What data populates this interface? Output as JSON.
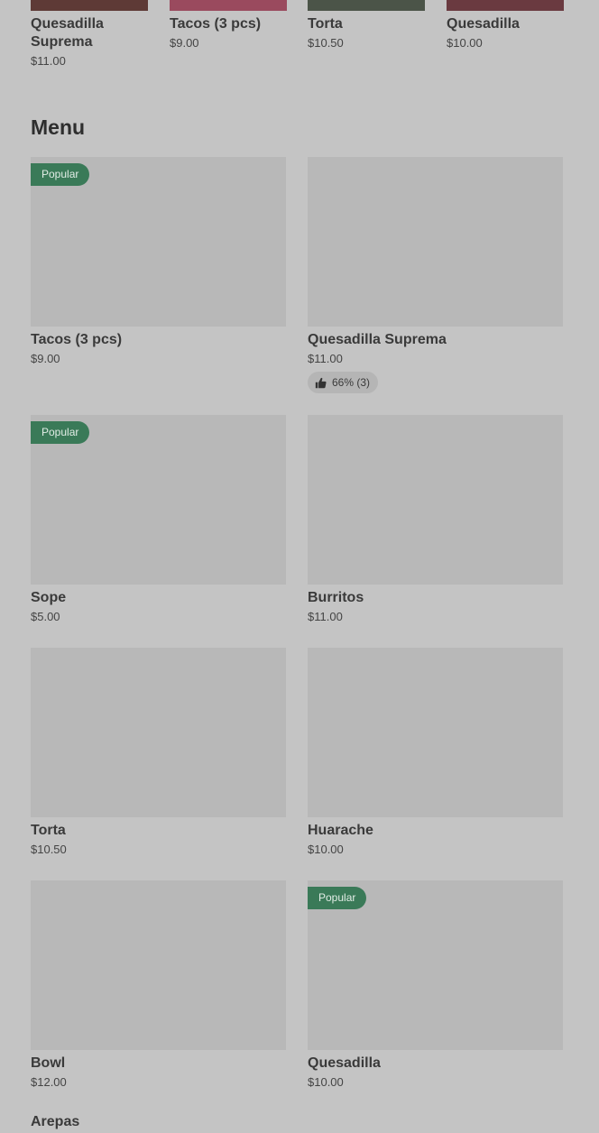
{
  "colors": {
    "background": "#c4c4c4",
    "popular_badge": "#3a7a58",
    "placeholder_image": "#b8b8b8"
  },
  "carousel": {
    "items": [
      {
        "title": "Quesadilla Suprema",
        "price": "$11.00",
        "image_color": "#5e3a36"
      },
      {
        "title": "Tacos (3 pcs)",
        "price": "$9.00",
        "image_color": "#9a4a5e"
      },
      {
        "title": "Torta",
        "price": "$10.50",
        "image_color": "#4b5448"
      },
      {
        "title": "Quesadilla",
        "price": "$10.00",
        "image_color": "#6a3a40"
      }
    ]
  },
  "menu": {
    "title": "Menu",
    "items": [
      {
        "title": "Tacos (3 pcs)",
        "price": "$9.00",
        "badge": "Popular"
      },
      {
        "title": "Quesadilla Suprema",
        "price": "$11.00",
        "rating": "66% (3)"
      },
      {
        "title": "Sope",
        "price": "$5.00",
        "badge": "Popular"
      },
      {
        "title": "Burritos",
        "price": "$11.00"
      },
      {
        "title": "Torta",
        "price": "$10.50"
      },
      {
        "title": "Huarache",
        "price": "$10.00"
      },
      {
        "title": "Bowl",
        "price": "$12.00"
      },
      {
        "title": "Quesadilla",
        "price": "$10.00",
        "badge": "Popular"
      }
    ],
    "next_item_title": "Arepas"
  }
}
